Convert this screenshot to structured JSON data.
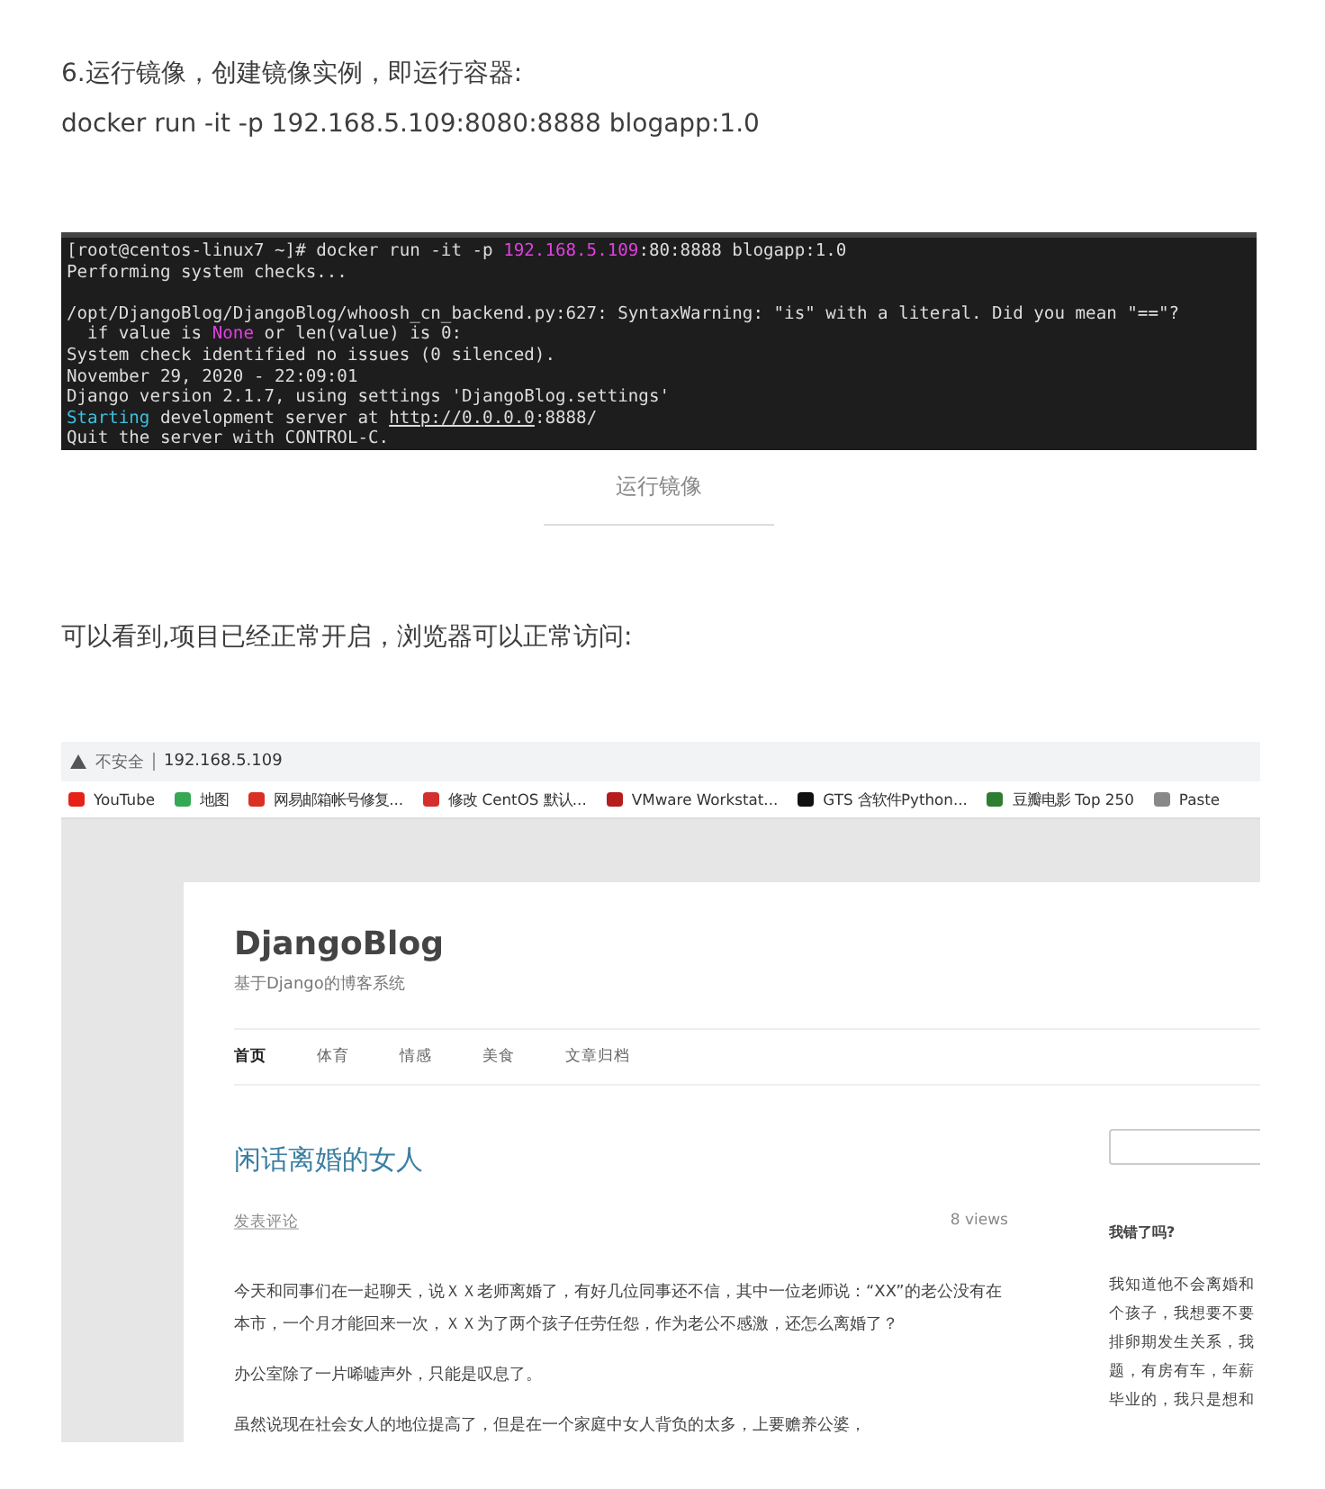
{
  "step_heading": "6.运行镜像，创建镜像实例，即运行容器:",
  "command": "docker run -it -p 192.168.5.109:8080:8888 blogapp:1.0",
  "terminal": {
    "lines": [
      {
        "kind": "text",
        "segments": [
          {
            "text": "[root@centos-linux7 ~]# docker run -it -p ",
            "kind": "plain"
          },
          {
            "text": "192.168.5.109",
            "kind": "magenta"
          },
          {
            "text": ":80:8888 blogapp:1.0",
            "kind": "plain"
          }
        ]
      },
      {
        "kind": "text",
        "segments": [
          {
            "text": "Performing system checks...",
            "kind": "plain"
          }
        ]
      },
      {
        "kind": "blank"
      },
      {
        "kind": "text",
        "segments": [
          {
            "text": "/opt/DjangoBlog/DjangoBlog/whoosh_cn_backend.py:627: SyntaxWarning: \"is\" with a literal. Did you mean \"==\"?",
            "kind": "plain"
          }
        ]
      },
      {
        "kind": "text",
        "segments": [
          {
            "text": "  if value is ",
            "kind": "plain"
          },
          {
            "text": "None",
            "kind": "magenta"
          },
          {
            "text": " or len(value) is 0:",
            "kind": "plain"
          }
        ]
      },
      {
        "kind": "text",
        "segments": [
          {
            "text": "System check identified no issues (0 silenced).",
            "kind": "plain"
          }
        ]
      },
      {
        "kind": "text",
        "segments": [
          {
            "text": "November 29, 2020 - 22:09:01",
            "kind": "plain"
          }
        ]
      },
      {
        "kind": "text",
        "segments": [
          {
            "text": "Django version 2.1.7, using settings 'DjangoBlog.settings'",
            "kind": "plain"
          }
        ]
      },
      {
        "kind": "text",
        "segments": [
          {
            "text": "Starting",
            "kind": "cyan"
          },
          {
            "text": " development server at ",
            "kind": "plain"
          },
          {
            "text": "http://0.0.0.0",
            "kind": "link"
          },
          {
            "text": ":8888/",
            "kind": "plain"
          }
        ]
      },
      {
        "kind": "text",
        "segments": [
          {
            "text": "Quit the server with CONTROL-C.",
            "kind": "plain"
          }
        ]
      }
    ]
  },
  "terminal_caption": "运行镜像",
  "paragraph": "可以看到,项目已经正常开启，浏览器可以正常访问:",
  "browser": {
    "security_label": "不安全",
    "address": "192.168.5.109",
    "bookmarks": [
      {
        "label": "YouTube",
        "color": "#e62117"
      },
      {
        "label": "地图",
        "color": "#34a853"
      },
      {
        "label": "网易邮箱帐号修复...",
        "color": "#d93025"
      },
      {
        "label": "修改 CentOS 默认...",
        "color": "#d32f2f"
      },
      {
        "label": "VMware Workstat...",
        "color": "#b71c1c"
      },
      {
        "label": "GTS 含软件Python...",
        "color": "#111111"
      },
      {
        "label": "豆瓣电影 Top 250",
        "color": "#2e7d32"
      },
      {
        "label": "Paste",
        "color": "#888888"
      }
    ],
    "site": {
      "title": "DjangoBlog",
      "tagline": "基于Django的博客系统",
      "nav": [
        {
          "label": "首页",
          "selected": true
        },
        {
          "label": "体育",
          "selected": false
        },
        {
          "label": "情感",
          "selected": false
        },
        {
          "label": "美食",
          "selected": false
        },
        {
          "label": "文章归档",
          "selected": false
        }
      ],
      "post": {
        "title": "闲话离婚的女人",
        "comment_link": "发表评论",
        "views": "8 views",
        "paragraphs": [
          "今天和同事们在一起聊天，说ＸＸ老师离婚了，有好几位同事还不信，其中一位老师说：“XX”的老公没有在本市，一个月才能回来一次，ＸＸ为了两个孩子任劳任怨，作为老公不感激，还怎么离婚了？",
          "办公室除了一片唏嘘声外，只能是叹息了。",
          "虽然说现在社会女人的地位提高了，但是在一个家庭中女人背负的太多，上要赡养公婆，"
        ]
      },
      "sidebar": {
        "heading": "我错了吗?",
        "lines": [
          "我知道他不会离婚和",
          "个孩子，我想要不要",
          "排卵期发生关系，我",
          "题，有房有车，年薪",
          "毕业的，我只是想和"
        ]
      }
    }
  }
}
